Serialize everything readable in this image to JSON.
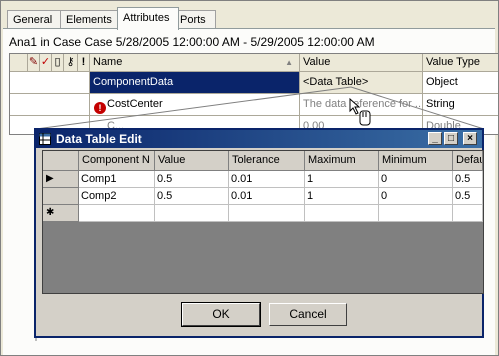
{
  "tabs": [
    "General",
    "Elements",
    "Attributes",
    "Ports"
  ],
  "caption": "Ana1 in Case Case 5/28/2005 12:00:00 AM - 5/29/2005 12:00:00 AM",
  "attr_grid": {
    "columns": {
      "name": "Name",
      "value": "Value",
      "value_type": "Value Type",
      "sort_arrow": "▲"
    },
    "rows": [
      {
        "name": "ComponentData",
        "value": "<Data Table>",
        "value_type": "Object"
      },
      {
        "name": "CostCenter",
        "value": "The data reference for ...",
        "value_type": "String"
      },
      {
        "name": "C...",
        "value": "0.00",
        "value_type": "Double"
      }
    ]
  },
  "dialog": {
    "title": "Data Table Edit",
    "columns": [
      "Component N",
      "Value",
      "Tolerance",
      "Maximum",
      "Minimum",
      "Defau"
    ],
    "rows": [
      [
        "Comp1",
        "0.5",
        "0.01",
        "1",
        "0",
        "0.5"
      ],
      [
        "Comp2",
        "0.5",
        "0.01",
        "1",
        "0",
        "0.5"
      ]
    ],
    "new_row_marker": "✱",
    "current_row_marker": "▶",
    "ok": "OK",
    "cancel": "Cancel"
  }
}
